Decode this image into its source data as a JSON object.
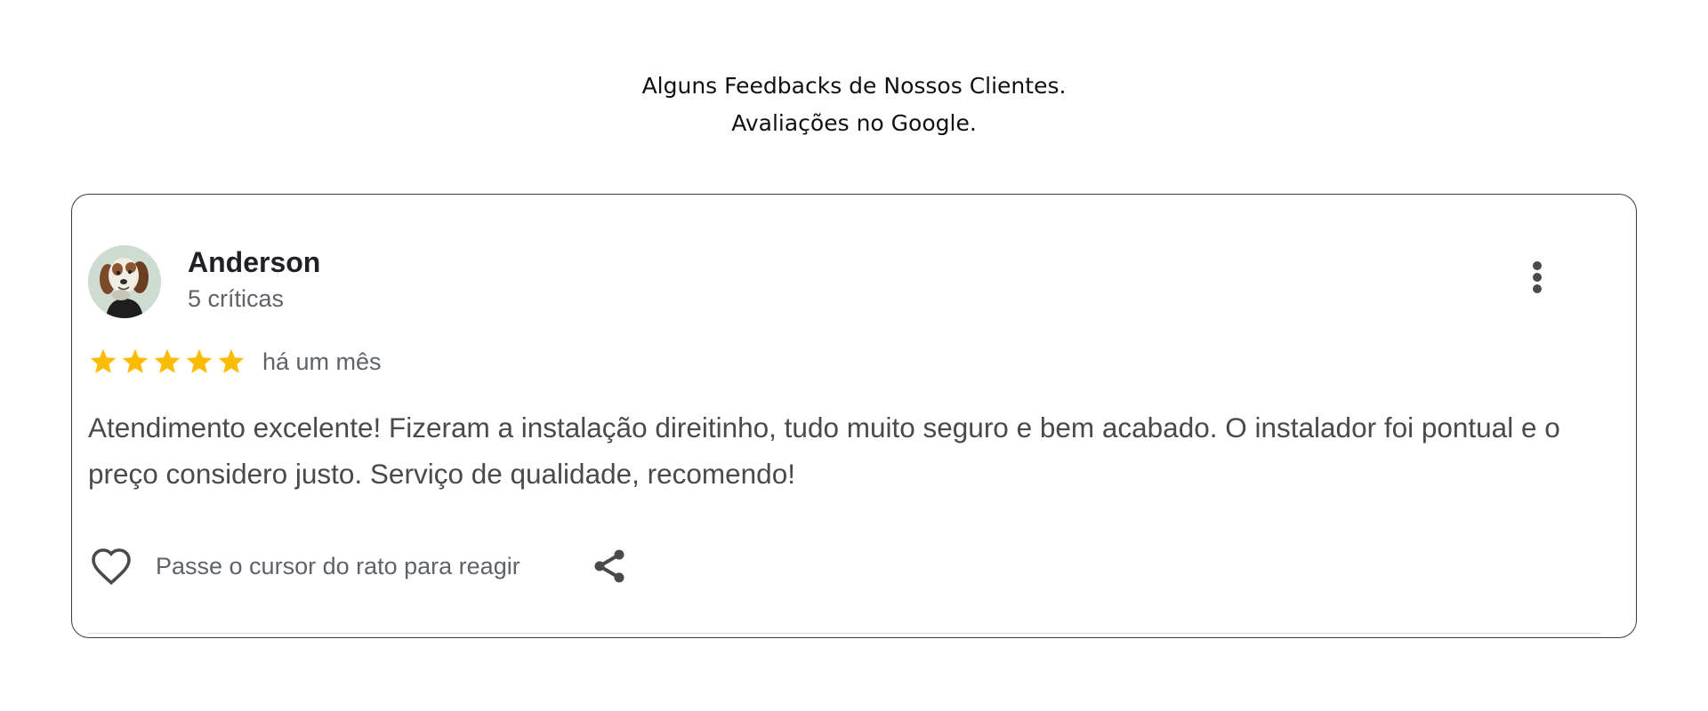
{
  "section": {
    "title_line1": "Alguns Feedbacks de Nossos Clientes.",
    "title_line2": "Avaliações no Google."
  },
  "review": {
    "author_name": "Anderson",
    "author_meta": "5 críticas",
    "rating": 5,
    "rating_max": 5,
    "date": "há um mês",
    "text": "Atendimento excelente! Fizeram a instalação direitinho, tudo muito seguro e bem acabado. O instalador foi pontual e o preço considero justo. Serviço de qualidade, recomendo!",
    "react_hint": "Passe o cursor do rato para reagir",
    "icons": {
      "avatar": "dog-avatar-icon",
      "menu": "more-vertical-icon",
      "star": "star-icon",
      "react": "heart-icon",
      "share": "share-icon"
    }
  },
  "colors": {
    "star": "#FBBC04",
    "text_primary": "#202124",
    "text_secondary": "#5f6368",
    "border": "#3c3c3c"
  }
}
